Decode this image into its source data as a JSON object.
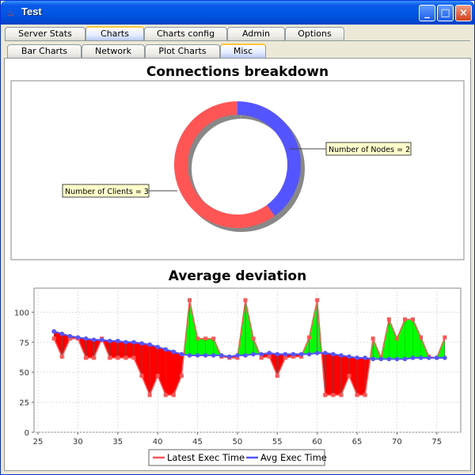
{
  "window": {
    "title": "Test"
  },
  "tabs_main": [
    {
      "label": "Server Stats"
    },
    {
      "label": "Charts"
    },
    {
      "label": "Charts config"
    },
    {
      "label": "Admin"
    },
    {
      "label": "Options"
    }
  ],
  "tabs_sub": [
    {
      "label": "Bar Charts"
    },
    {
      "label": "Network"
    },
    {
      "label": "Plot Charts"
    },
    {
      "label": "Misc"
    }
  ],
  "active_main_tab": "Charts",
  "active_sub_tab": "Misc",
  "colors": {
    "clients": "#ff5555",
    "nodes": "#5555ff",
    "latest": "#ff5555",
    "avg": "#5555ff",
    "above": "#00ff00",
    "below": "#ff0000",
    "titlebar": "#0054e3"
  },
  "chart_data": [
    {
      "type": "pie",
      "title": "Connections breakdown",
      "labels": [
        "Number of Clients",
        "Number of Nodes"
      ],
      "values": [
        3,
        2
      ],
      "label_texts": [
        "Number of Clients = 3",
        "Number of Nodes = 2"
      ],
      "style": "ring"
    },
    {
      "type": "line",
      "title": "Average deviation",
      "xlabel": "",
      "ylabel": "",
      "xlim": [
        24.5,
        78
      ],
      "ylim": [
        0,
        120
      ],
      "xticks": [
        25,
        30,
        35,
        40,
        45,
        50,
        55,
        60,
        65,
        70,
        75
      ],
      "yticks": [
        0,
        25,
        50,
        75,
        100
      ],
      "grid": true,
      "legend": "bottom",
      "x": [
        27,
        28,
        29,
        30,
        31,
        32,
        33,
        34,
        35,
        36,
        37,
        38,
        39,
        40,
        41,
        42,
        43,
        44,
        45,
        46,
        47,
        48,
        49,
        50,
        51,
        52,
        53,
        54,
        55,
        56,
        57,
        58,
        59,
        60,
        61,
        62,
        63,
        64,
        65,
        66,
        67,
        68,
        69,
        70,
        71,
        72,
        73,
        74,
        75,
        76
      ],
      "series": [
        {
          "name": "Latest Exec Time",
          "values": [
            78,
            63,
            78,
            78,
            62,
            62,
            78,
            62,
            62,
            62,
            62,
            47,
            31,
            47,
            31,
            31,
            47,
            110,
            78,
            78,
            78,
            63,
            62,
            62,
            110,
            78,
            62,
            63,
            47,
            62,
            63,
            63,
            79,
            110,
            31,
            31,
            31,
            47,
            31,
            31,
            78,
            62,
            94,
            78,
            94,
            94,
            79,
            63,
            62,
            79
          ]
        },
        {
          "name": "Avg Exec Time",
          "values": [
            84,
            82,
            80,
            79,
            78,
            77,
            77,
            76,
            76,
            75,
            75,
            74,
            73,
            71,
            69,
            67,
            65,
            64,
            64,
            64,
            64,
            64,
            63,
            64,
            64,
            65,
            65,
            66,
            65,
            65,
            65,
            65,
            65,
            66,
            66,
            65,
            64,
            63,
            62,
            62,
            61,
            61,
            61,
            61,
            61,
            62,
            62,
            62,
            62,
            62
          ]
        }
      ]
    }
  ],
  "legend": {
    "latest_label": "Latest Exec Time",
    "avg_label": "Avg Exec Time"
  }
}
